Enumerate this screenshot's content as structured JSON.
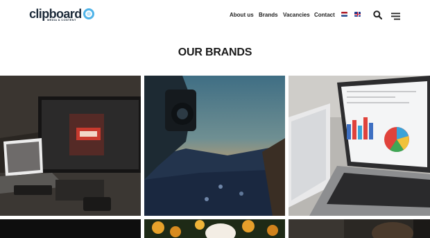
{
  "header": {
    "logo": {
      "word": "clipboard",
      "tagline": "MEDIA & CONTENT",
      "accent": "#4fb3e8"
    },
    "nav": [
      {
        "label": "About us"
      },
      {
        "label": "Brands"
      },
      {
        "label": "Vacancies"
      },
      {
        "label": "Contact"
      }
    ],
    "languages": [
      "flag-nl-icon",
      "flag-en-icon"
    ],
    "icons": [
      "search-icon",
      "menu-icon"
    ]
  },
  "main": {
    "title": "OUR BRANDS"
  },
  "colors": {
    "text": "#1a1a1a",
    "brand_blue": "#4fb3e8",
    "background": "#ffffff"
  }
}
